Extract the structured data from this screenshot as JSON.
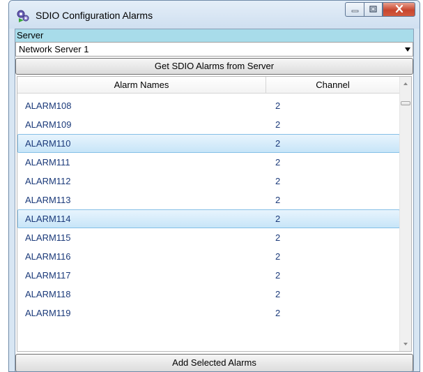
{
  "window": {
    "title": "SDIO Configuration Alarms",
    "icons": {
      "app": "gears-icon",
      "minimize": "minimize-icon",
      "maximize": "maximize-icon",
      "close": "close-icon"
    }
  },
  "server": {
    "label": "Server",
    "selected": "Network Server 1"
  },
  "buttons": {
    "get_alarms": "Get SDIO Alarms from Server",
    "add_selected": "Add Selected Alarms"
  },
  "grid": {
    "columns": [
      "Alarm Names",
      "Channel"
    ],
    "rows": [
      {
        "name": "ALARM108",
        "channel": "2",
        "selected": false
      },
      {
        "name": "ALARM109",
        "channel": "2",
        "selected": false
      },
      {
        "name": "ALARM110",
        "channel": "2",
        "selected": true
      },
      {
        "name": "ALARM111",
        "channel": "2",
        "selected": false
      },
      {
        "name": "ALARM112",
        "channel": "2",
        "selected": false
      },
      {
        "name": "ALARM113",
        "channel": "2",
        "selected": false
      },
      {
        "name": "ALARM114",
        "channel": "2",
        "selected": true
      },
      {
        "name": "ALARM115",
        "channel": "2",
        "selected": false
      },
      {
        "name": "ALARM116",
        "channel": "2",
        "selected": false
      },
      {
        "name": "ALARM117",
        "channel": "2",
        "selected": false
      },
      {
        "name": "ALARM118",
        "channel": "2",
        "selected": false
      },
      {
        "name": "ALARM119",
        "channel": "2",
        "selected": false
      }
    ]
  },
  "colors": {
    "server_label_bg": "#a8dcea",
    "selection_bg": "#c7e5f8",
    "selection_border": "#84bfe6",
    "row_text": "#1b3a7a",
    "close_button": "#c8462e"
  }
}
